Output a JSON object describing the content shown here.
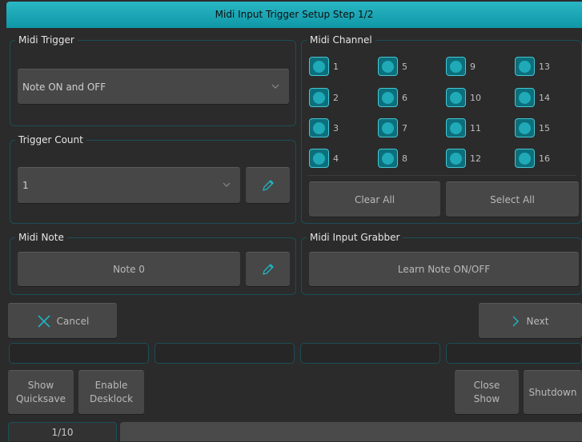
{
  "title": "Midi Input Trigger Setup Step 1/2",
  "midi_trigger": {
    "title": "Midi Trigger",
    "selected": "Note ON and OFF"
  },
  "trigger_count": {
    "title": "Trigger Count",
    "selected": "1"
  },
  "midi_note": {
    "title": "Midi Note",
    "value": "Note 0"
  },
  "midi_channel": {
    "title": "Midi Channel",
    "channels": [
      "1",
      "2",
      "3",
      "4",
      "5",
      "6",
      "7",
      "8",
      "9",
      "10",
      "11",
      "12",
      "13",
      "14",
      "15",
      "16"
    ],
    "checked": [
      true,
      true,
      true,
      true,
      true,
      true,
      true,
      true,
      true,
      true,
      true,
      true,
      true,
      true,
      true,
      true
    ],
    "clear_all": "Clear All",
    "select_all": "Select All"
  },
  "grabber": {
    "title": "Midi Input Grabber",
    "learn": "Learn Note ON/OFF"
  },
  "nav": {
    "cancel": "Cancel",
    "next": "Next"
  },
  "footer": {
    "show_quicksave_1": "Show",
    "show_quicksave_2": "Quicksave",
    "enable_desklock_1": "Enable",
    "enable_desklock_2": "Desklock",
    "close_show_1": "Close",
    "close_show_2": "Show",
    "shutdown": "Shutdown",
    "page": "1/10"
  },
  "accent": "#1aa6b5"
}
